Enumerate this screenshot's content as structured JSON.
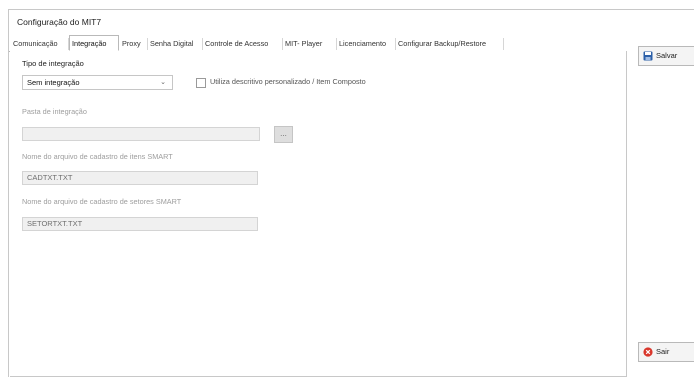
{
  "window": {
    "title": "Configuração do MIT7"
  },
  "tabs": [
    {
      "label": "Comunicação",
      "active": false
    },
    {
      "label": "Integração",
      "active": true
    },
    {
      "label": "Proxy",
      "active": false
    },
    {
      "label": "Senha Digital",
      "active": false
    },
    {
      "label": "Controle de Acesso",
      "active": false
    },
    {
      "label": "MIT- Player",
      "active": false
    },
    {
      "label": "Licenciamento",
      "active": false
    },
    {
      "label": "Configurar Backup/Restore",
      "active": false
    }
  ],
  "integration": {
    "type_label": "Tipo de integração",
    "type_value": "Sem integração",
    "custom_description_checkbox": {
      "label": "Utiliza descritivo personalizado / Item Composto",
      "checked": false
    },
    "folder_label": "Pasta de integração",
    "folder_value": "",
    "browse_label": "...",
    "items_file_label": "Nome do arquivo de cadastro de itens SMART",
    "items_file_value": "CADTXT.TXT",
    "sectors_file_label": "Nome do arquivo de cadastro de setores SMART",
    "sectors_file_value": "SETORTXT.TXT"
  },
  "actions": {
    "save_label": "Salvar",
    "exit_label": "Sair"
  },
  "icons": {
    "save": "floppy-disk-icon",
    "exit": "close-circle-icon",
    "dropdown": "chevron-down-icon"
  },
  "colors": {
    "save_icon": "#2b5fa8",
    "exit_icon": "#d9362b"
  }
}
